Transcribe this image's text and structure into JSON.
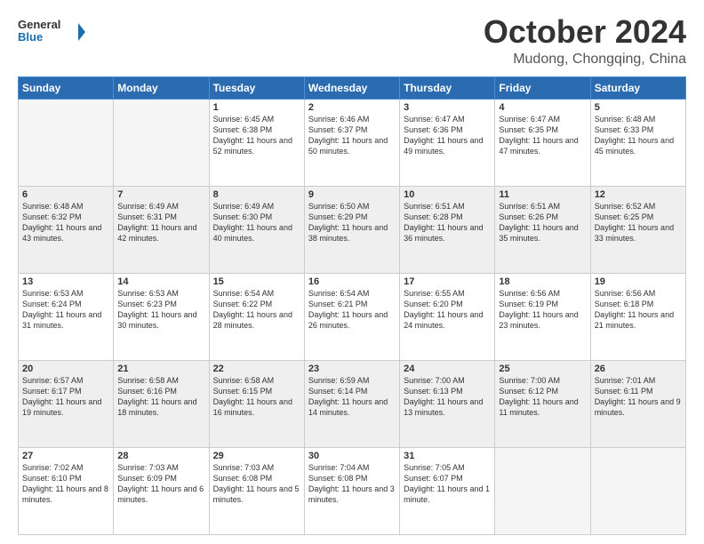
{
  "header": {
    "logo_line1": "General",
    "logo_line2": "Blue",
    "month": "October 2024",
    "location": "Mudong, Chongqing, China"
  },
  "weekdays": [
    "Sunday",
    "Monday",
    "Tuesday",
    "Wednesday",
    "Thursday",
    "Friday",
    "Saturday"
  ],
  "rows": [
    [
      {
        "day": "",
        "sunrise": "",
        "sunset": "",
        "daylight": ""
      },
      {
        "day": "",
        "sunrise": "",
        "sunset": "",
        "daylight": ""
      },
      {
        "day": "1",
        "sunrise": "Sunrise: 6:45 AM",
        "sunset": "Sunset: 6:38 PM",
        "daylight": "Daylight: 11 hours and 52 minutes."
      },
      {
        "day": "2",
        "sunrise": "Sunrise: 6:46 AM",
        "sunset": "Sunset: 6:37 PM",
        "daylight": "Daylight: 11 hours and 50 minutes."
      },
      {
        "day": "3",
        "sunrise": "Sunrise: 6:47 AM",
        "sunset": "Sunset: 6:36 PM",
        "daylight": "Daylight: 11 hours and 49 minutes."
      },
      {
        "day": "4",
        "sunrise": "Sunrise: 6:47 AM",
        "sunset": "Sunset: 6:35 PM",
        "daylight": "Daylight: 11 hours and 47 minutes."
      },
      {
        "day": "5",
        "sunrise": "Sunrise: 6:48 AM",
        "sunset": "Sunset: 6:33 PM",
        "daylight": "Daylight: 11 hours and 45 minutes."
      }
    ],
    [
      {
        "day": "6",
        "sunrise": "Sunrise: 6:48 AM",
        "sunset": "Sunset: 6:32 PM",
        "daylight": "Daylight: 11 hours and 43 minutes."
      },
      {
        "day": "7",
        "sunrise": "Sunrise: 6:49 AM",
        "sunset": "Sunset: 6:31 PM",
        "daylight": "Daylight: 11 hours and 42 minutes."
      },
      {
        "day": "8",
        "sunrise": "Sunrise: 6:49 AM",
        "sunset": "Sunset: 6:30 PM",
        "daylight": "Daylight: 11 hours and 40 minutes."
      },
      {
        "day": "9",
        "sunrise": "Sunrise: 6:50 AM",
        "sunset": "Sunset: 6:29 PM",
        "daylight": "Daylight: 11 hours and 38 minutes."
      },
      {
        "day": "10",
        "sunrise": "Sunrise: 6:51 AM",
        "sunset": "Sunset: 6:28 PM",
        "daylight": "Daylight: 11 hours and 36 minutes."
      },
      {
        "day": "11",
        "sunrise": "Sunrise: 6:51 AM",
        "sunset": "Sunset: 6:26 PM",
        "daylight": "Daylight: 11 hours and 35 minutes."
      },
      {
        "day": "12",
        "sunrise": "Sunrise: 6:52 AM",
        "sunset": "Sunset: 6:25 PM",
        "daylight": "Daylight: 11 hours and 33 minutes."
      }
    ],
    [
      {
        "day": "13",
        "sunrise": "Sunrise: 6:53 AM",
        "sunset": "Sunset: 6:24 PM",
        "daylight": "Daylight: 11 hours and 31 minutes."
      },
      {
        "day": "14",
        "sunrise": "Sunrise: 6:53 AM",
        "sunset": "Sunset: 6:23 PM",
        "daylight": "Daylight: 11 hours and 30 minutes."
      },
      {
        "day": "15",
        "sunrise": "Sunrise: 6:54 AM",
        "sunset": "Sunset: 6:22 PM",
        "daylight": "Daylight: 11 hours and 28 minutes."
      },
      {
        "day": "16",
        "sunrise": "Sunrise: 6:54 AM",
        "sunset": "Sunset: 6:21 PM",
        "daylight": "Daylight: 11 hours and 26 minutes."
      },
      {
        "day": "17",
        "sunrise": "Sunrise: 6:55 AM",
        "sunset": "Sunset: 6:20 PM",
        "daylight": "Daylight: 11 hours and 24 minutes."
      },
      {
        "day": "18",
        "sunrise": "Sunrise: 6:56 AM",
        "sunset": "Sunset: 6:19 PM",
        "daylight": "Daylight: 11 hours and 23 minutes."
      },
      {
        "day": "19",
        "sunrise": "Sunrise: 6:56 AM",
        "sunset": "Sunset: 6:18 PM",
        "daylight": "Daylight: 11 hours and 21 minutes."
      }
    ],
    [
      {
        "day": "20",
        "sunrise": "Sunrise: 6:57 AM",
        "sunset": "Sunset: 6:17 PM",
        "daylight": "Daylight: 11 hours and 19 minutes."
      },
      {
        "day": "21",
        "sunrise": "Sunrise: 6:58 AM",
        "sunset": "Sunset: 6:16 PM",
        "daylight": "Daylight: 11 hours and 18 minutes."
      },
      {
        "day": "22",
        "sunrise": "Sunrise: 6:58 AM",
        "sunset": "Sunset: 6:15 PM",
        "daylight": "Daylight: 11 hours and 16 minutes."
      },
      {
        "day": "23",
        "sunrise": "Sunrise: 6:59 AM",
        "sunset": "Sunset: 6:14 PM",
        "daylight": "Daylight: 11 hours and 14 minutes."
      },
      {
        "day": "24",
        "sunrise": "Sunrise: 7:00 AM",
        "sunset": "Sunset: 6:13 PM",
        "daylight": "Daylight: 11 hours and 13 minutes."
      },
      {
        "day": "25",
        "sunrise": "Sunrise: 7:00 AM",
        "sunset": "Sunset: 6:12 PM",
        "daylight": "Daylight: 11 hours and 11 minutes."
      },
      {
        "day": "26",
        "sunrise": "Sunrise: 7:01 AM",
        "sunset": "Sunset: 6:11 PM",
        "daylight": "Daylight: 11 hours and 9 minutes."
      }
    ],
    [
      {
        "day": "27",
        "sunrise": "Sunrise: 7:02 AM",
        "sunset": "Sunset: 6:10 PM",
        "daylight": "Daylight: 11 hours and 8 minutes."
      },
      {
        "day": "28",
        "sunrise": "Sunrise: 7:03 AM",
        "sunset": "Sunset: 6:09 PM",
        "daylight": "Daylight: 11 hours and 6 minutes."
      },
      {
        "day": "29",
        "sunrise": "Sunrise: 7:03 AM",
        "sunset": "Sunset: 6:08 PM",
        "daylight": "Daylight: 11 hours and 5 minutes."
      },
      {
        "day": "30",
        "sunrise": "Sunrise: 7:04 AM",
        "sunset": "Sunset: 6:08 PM",
        "daylight": "Daylight: 11 hours and 3 minutes."
      },
      {
        "day": "31",
        "sunrise": "Sunrise: 7:05 AM",
        "sunset": "Sunset: 6:07 PM",
        "daylight": "Daylight: 11 hours and 1 minute."
      },
      {
        "day": "",
        "sunrise": "",
        "sunset": "",
        "daylight": ""
      },
      {
        "day": "",
        "sunrise": "",
        "sunset": "",
        "daylight": ""
      }
    ]
  ]
}
